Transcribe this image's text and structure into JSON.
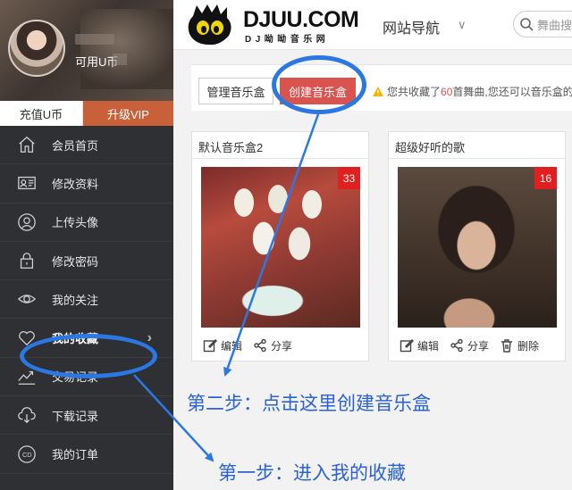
{
  "profile": {
    "coin_label": "可用U币"
  },
  "sidebar": {
    "recharge_label": "充值U币",
    "vip_label": "升级VIP",
    "items": [
      {
        "label": "会员首页",
        "icon": "home-icon"
      },
      {
        "label": "修改资料",
        "icon": "id-card-icon"
      },
      {
        "label": "上传头像",
        "icon": "user-icon"
      },
      {
        "label": "修改密码",
        "icon": "lock-icon"
      },
      {
        "label": "我的关注",
        "icon": "eye-icon"
      },
      {
        "label": "我的收藏",
        "icon": "heart-icon",
        "active": true,
        "arrow": "›"
      },
      {
        "label": "交易记录",
        "icon": "trend-icon"
      },
      {
        "label": "下载记录",
        "icon": "cloud-download-icon"
      },
      {
        "label": "我的订单",
        "icon": "cd-icon"
      }
    ]
  },
  "header": {
    "logo_text": "DJUU.COM",
    "logo_sub": "DJ呦呦音乐网",
    "nav_label": "网站导航",
    "search_placeholder": "舞曲搜"
  },
  "toolbar": {
    "manage_label": "管理音乐盒",
    "create_label": "创建音乐盒",
    "notice_prefix": "您共收藏了",
    "notice_count": "60",
    "notice_suffix": " 首舞曲,您还可以音乐盒的"
  },
  "cards": [
    {
      "title": "默认音乐盒2",
      "count": "33",
      "actions": [
        "编辑",
        "分享"
      ]
    },
    {
      "title": "超级好听的歌",
      "count": "16",
      "actions": [
        "编辑",
        "分享",
        "删除"
      ]
    }
  ],
  "annotations": {
    "step2": "第二步：点击这里创建音乐盒",
    "step1": "第一步：进入我的收藏"
  },
  "colors": {
    "sidebar_bg": "#2e3033",
    "vip_orange": "#c8613a",
    "create_red": "#d9534f",
    "badge_red": "#e02020",
    "annotation_blue": "#2b78e4"
  }
}
